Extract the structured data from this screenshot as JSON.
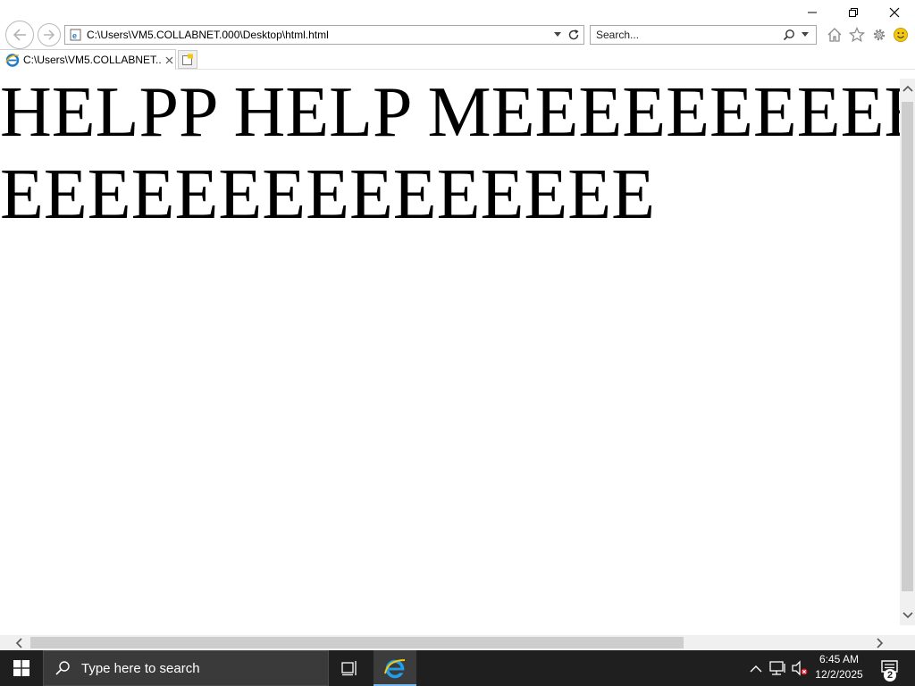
{
  "browser": {
    "address": "C:\\Users\\VM5.COLLABNET.000\\Desktop\\html.html",
    "search_placeholder": "Search...",
    "tab_title": "C:\\Users\\VM5.COLLABNET...."
  },
  "page": {
    "heading": "HELPP HELP MEEEEEEEEEEEEEEEEEEEEEEEEE"
  },
  "taskbar": {
    "search_placeholder": "Type here to search",
    "time": "6:45 AM",
    "date": "12/2/2025",
    "notification_count": "2"
  },
  "icons": {
    "back": "back-arrow-icon",
    "forward": "forward-arrow-icon",
    "home": "home-icon",
    "favorites": "star-icon",
    "tools": "gear-icon",
    "feedback": "smiley-icon",
    "start": "windows-logo-icon",
    "ie": "internet-explorer-icon"
  },
  "colors": {
    "taskbar": "#1f1f1f",
    "ie_blue": "#1e7ac8",
    "accent_underline": "#76b9ed"
  }
}
